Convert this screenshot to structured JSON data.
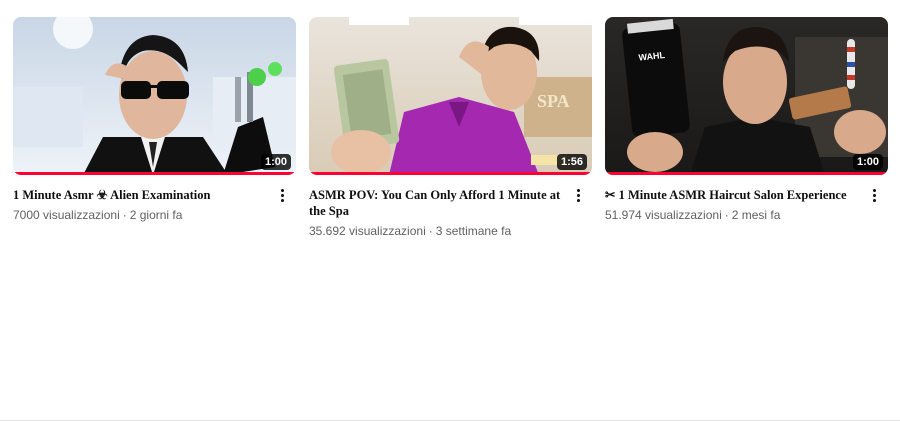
{
  "videos": [
    {
      "title": "1 Minute Asmr ☣ Alien Examination",
      "views": "7000 visualizzazioni",
      "age": "2 giorni fa",
      "duration": "1:00",
      "progress": 1.0
    },
    {
      "title": "ASMR POV: You Can Only Afford 1 Minute at the Spa",
      "views": "35.692 visualizzazioni",
      "age": "3 settimane fa",
      "duration": "1:56",
      "progress": 1.0,
      "thumb_text": "SPA"
    },
    {
      "title": "✂ 1 Minute ASMR Haircut Salon Experience",
      "views": "51.974 visualizzazioni",
      "age": "2 mesi fa",
      "duration": "1:00",
      "progress": 1.0,
      "thumb_text": "WAHL"
    }
  ],
  "colors": {
    "progress": "#ff0033",
    "title": "#0f0f0f",
    "meta": "#606060"
  },
  "icons": {
    "menu": "more-vert-icon"
  }
}
